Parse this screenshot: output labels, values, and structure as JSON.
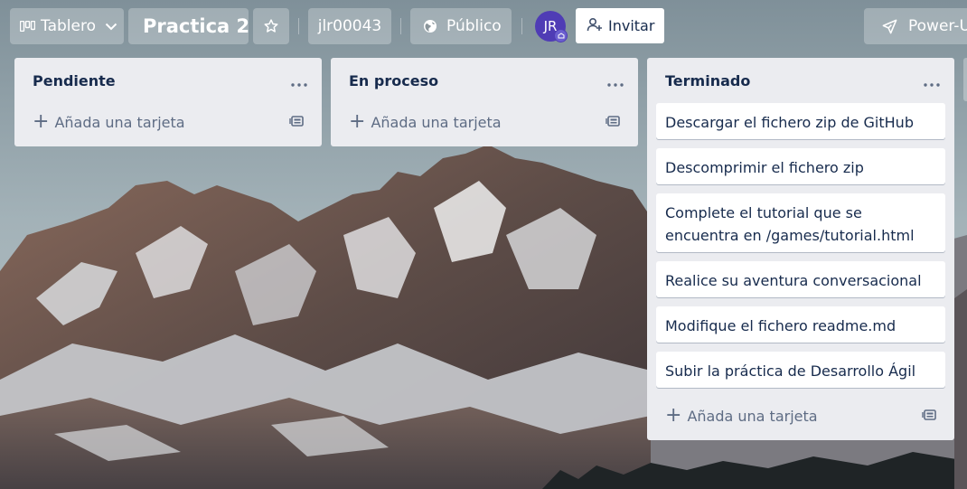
{
  "header": {
    "board_switcher_label": "Tablero",
    "board_name": "Practica 2",
    "workspace": "jlr00043",
    "visibility": "Público",
    "member_initials": "JR",
    "invite_label": "Invitar",
    "powerups_label": "Power-U"
  },
  "lists": [
    {
      "title": "Pendiente",
      "cards": [],
      "add_label": "Añada una tarjeta"
    },
    {
      "title": "En proceso",
      "cards": [],
      "add_label": "Añada una tarjeta"
    },
    {
      "title": "Terminado",
      "cards": [
        "Descargar el fichero zip de GitHub",
        "Descomprimir el fichero zip",
        "Complete el tutorial que se encuentra en /games/tutorial.html",
        "Realice su aventura conversacional",
        "Modifique el fichero readme.md",
        "Subir la práctica de Desarrollo Ágil"
      ],
      "add_label": "Añada una tarjeta"
    }
  ],
  "icons": {
    "board_switcher": "board-icon",
    "star": "star-icon",
    "visibility": "globe-icon",
    "invite": "add-person-icon",
    "powerups": "rocket-icon",
    "list_menu": "more-dots-icon",
    "add_card": "plus-icon",
    "template": "card-template-icon"
  },
  "colors": {
    "list_bg": "#ebecf0",
    "card_bg": "#ffffff",
    "text": "#172b4d",
    "muted": "#5e6c84",
    "avatar": "#4f3cb5"
  }
}
